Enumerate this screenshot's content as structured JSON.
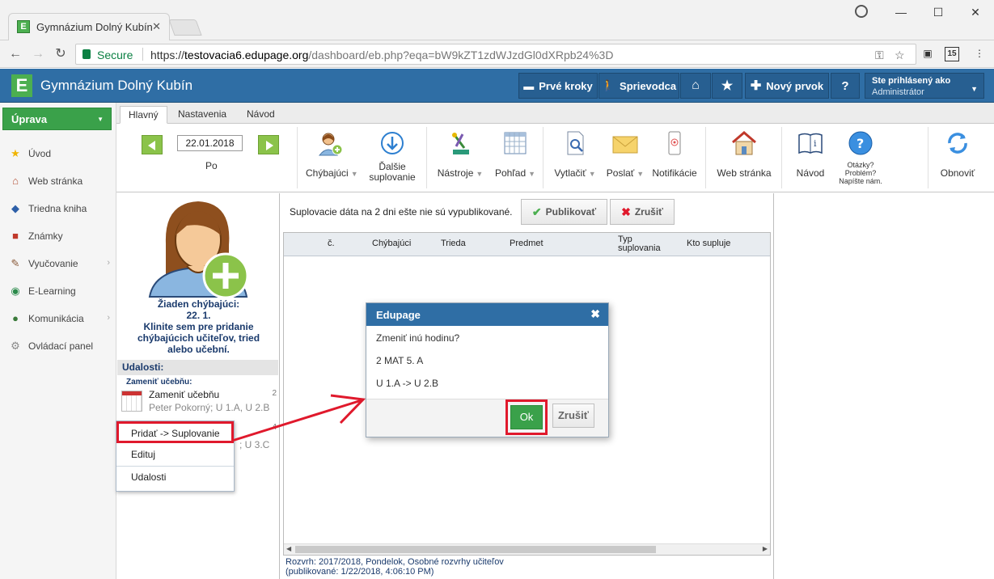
{
  "browser": {
    "tab_title": "Gymnázium Dolný Kubín",
    "favicon_letter": "E",
    "secure_label": "Secure",
    "url_scheme": "https://",
    "url_host": "testovacia6.edupage.org",
    "url_path": "/dashboard/eb.php?eqa=bW9kZT1zdWJzdGl0dXRpb24%3D",
    "ext_badge": "15"
  },
  "header": {
    "logo_letter": "E",
    "title": "Gymnázium Dolný Kubín",
    "buttons": [
      "Prvé kroky",
      "Sprievodca",
      "Nový prvok",
      "?"
    ],
    "user_line1": "Ste prihlásený ako",
    "user_line2": "Administrátor"
  },
  "sidebar": {
    "edit_label": "Úprava",
    "items": [
      {
        "label": "Úvod",
        "icon": "star-icon"
      },
      {
        "label": "Web stránka",
        "icon": "house-icon"
      },
      {
        "label": "Triedna kniha",
        "icon": "book-icon"
      },
      {
        "label": "Známky",
        "icon": "grade-icon"
      },
      {
        "label": "Vyučovanie",
        "icon": "teaching-icon"
      },
      {
        "label": "E-Learning",
        "icon": "globe-icon"
      },
      {
        "label": "Komunikácia",
        "icon": "chat-icon"
      },
      {
        "label": "Ovládací panel",
        "icon": "gear-icon"
      }
    ]
  },
  "ribbon": {
    "tabs": [
      "Hlavný",
      "Nastavenia",
      "Návod"
    ],
    "date": "22.01.2018",
    "day": "Po",
    "absent_label": "Chýbajúci",
    "more_sub_1": "Ďalšie",
    "more_sub_2": "suplovanie",
    "tools": "Nástroje",
    "view": "Pohľad",
    "print": "Vytlačiť",
    "send": "Poslať",
    "notifications": "Notifikácie",
    "web": "Web stránka",
    "guide": "Návod",
    "help_1": "Otázky?",
    "help_2": "Problém?",
    "help_3": "Napíšte nám.",
    "refresh": "Obnoviť"
  },
  "leftpanel": {
    "no_absent_1": "Žiaden chýbajúci:",
    "no_absent_2": "22. 1.",
    "no_absent_3": "Klinite sem pre pridanie",
    "no_absent_4": "chýbajúcich učiteľov, tried",
    "no_absent_5": "alebo učební.",
    "events_head": "Udalosti:",
    "events_sub": "Zameniť učebňu:",
    "event1_title": "Zameniť učebňu",
    "event1_detail": "Peter Pokorný; U 1.A, U 2.B",
    "event1_num": "2",
    "event2_detail": "; U 3.C",
    "event2_num": "4"
  },
  "context_menu": {
    "items": [
      "Pridať -> Suplovanie",
      "Edituj",
      "Udalosti"
    ]
  },
  "main": {
    "publish_msg": "Suplovacie dáta na 2 dni ešte nie sú vypublikované.",
    "publish_btn": "Publikovať",
    "cancel_btn": "Zrušiť",
    "columns": [
      "č.",
      "Chýbajúci",
      "Trieda",
      "Predmet",
      "Typ",
      "suplovania",
      "Kto supluje"
    ],
    "footer_1": "Rozvrh: 2017/2018, Pondelok, Osobné rozvrhy učiteľov",
    "footer_2": "(publikované: 1/22/2018, 4:06:10 PM)"
  },
  "dialog": {
    "title": "Edupage",
    "line1": "Zmeniť inú hodinu?",
    "line2": "2 MAT 5. A",
    "line3": "U 1.A -> U 2.B",
    "ok": "Ok",
    "cancel": "Zrušiť"
  },
  "colors": {
    "brand_blue": "#2f6ea5",
    "green": "#3aa14a",
    "highlight_red": "#e0192c"
  }
}
